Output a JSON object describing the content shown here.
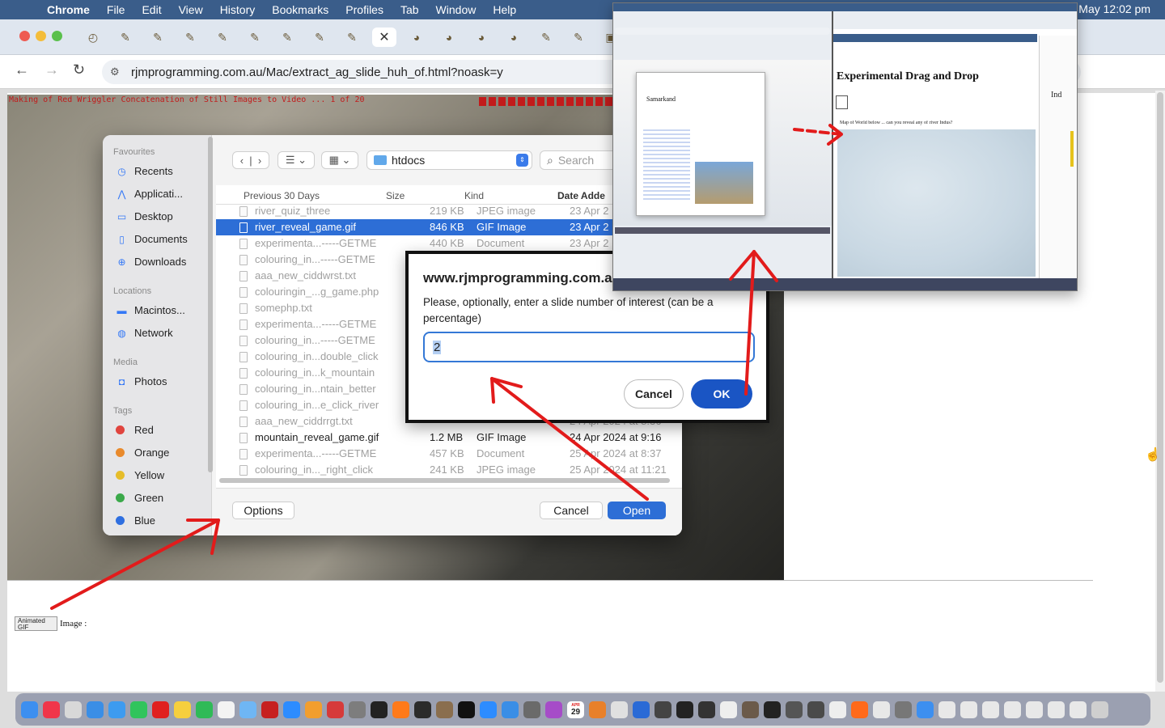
{
  "menubar": {
    "app": "Chrome",
    "items": [
      "File",
      "Edit",
      "View",
      "History",
      "Bookmarks",
      "Profiles",
      "Tab",
      "Window",
      "Help"
    ],
    "clock": "May  12:02 pm"
  },
  "browser": {
    "url": "rjmprogramming.com.au/Mac/extract_ag_slide_huh_of.html?noask=y",
    "tab_count": 20,
    "active_tab_close": "✕"
  },
  "page": {
    "strip_text": "Making of Red Wriggler Concatenation of Still Images to Video ... 1 of 20",
    "animated_gif_button": "Animated GIF",
    "image_label": "Image :"
  },
  "file_dialog": {
    "sidebar": {
      "favourites_heading": "Favourites",
      "favourites": [
        {
          "label": "Recents",
          "icon": "clock-icon"
        },
        {
          "label": "Applicati...",
          "icon": "apps-icon"
        },
        {
          "label": "Desktop",
          "icon": "desktop-icon"
        },
        {
          "label": "Documents",
          "icon": "document-icon"
        },
        {
          "label": "Downloads",
          "icon": "download-icon"
        }
      ],
      "locations_heading": "Locations",
      "locations": [
        {
          "label": "Macintos...",
          "icon": "disk-icon"
        },
        {
          "label": "Network",
          "icon": "globe-icon"
        }
      ],
      "media_heading": "Media",
      "media": [
        {
          "label": "Photos",
          "icon": "camera-icon"
        }
      ],
      "tags_heading": "Tags",
      "tags": [
        {
          "label": "Red",
          "color": "#e0443e"
        },
        {
          "label": "Orange",
          "color": "#e98a2c"
        },
        {
          "label": "Yellow",
          "color": "#e6bd2a"
        },
        {
          "label": "Green",
          "color": "#3ba94a"
        },
        {
          "label": "Blue",
          "color": "#2f6fe0"
        }
      ]
    },
    "folder": "htdocs",
    "search_placeholder": "Search",
    "columns": {
      "name": "Previous 30 Days",
      "size": "Size",
      "kind": "Kind",
      "date": "Date Adde"
    },
    "rows": [
      {
        "name": "river_quiz_three",
        "size": "219 KB",
        "kind": "JPEG image",
        "date": "23 Apr 2",
        "state": "dim"
      },
      {
        "name": "river_reveal_game.gif",
        "size": "846 KB",
        "kind": "GIF Image",
        "date": "23 Apr 2",
        "state": "selected"
      },
      {
        "name": "experimenta...-----GETME",
        "size": "440 KB",
        "kind": "Document",
        "date": "23 Apr 2",
        "state": "dim"
      },
      {
        "name": "colouring_in...-----GETME",
        "size": "",
        "kind": "",
        "date": "",
        "state": "dim"
      },
      {
        "name": "aaa_new_ciddwrst.txt",
        "size": "",
        "kind": "",
        "date": "",
        "state": "dim"
      },
      {
        "name": "colouringin_...g_game.php",
        "size": "",
        "kind": "",
        "date": "",
        "state": "dim"
      },
      {
        "name": "somephp.txt",
        "size": "",
        "kind": "",
        "date": "",
        "state": "dim"
      },
      {
        "name": "experimenta...-----GETME",
        "size": "",
        "kind": "",
        "date": "",
        "state": "dim"
      },
      {
        "name": "colouring_in...-----GETME",
        "size": "",
        "kind": "",
        "date": "",
        "state": "dim"
      },
      {
        "name": "colouring_in...double_click",
        "size": "",
        "kind": "",
        "date": "",
        "state": "dim"
      },
      {
        "name": "colouring_in...k_mountain",
        "size": "",
        "kind": "",
        "date": "",
        "state": "dim"
      },
      {
        "name": "colouring_in...ntain_better",
        "size": "",
        "kind": "",
        "date": "",
        "state": "dim"
      },
      {
        "name": "colouring_in...e_click_river",
        "size": "",
        "kind": "",
        "date": "",
        "state": "dim"
      },
      {
        "name": "aaa_new_ciddrrgt.txt",
        "size": "",
        "kind": "",
        "date": "24 Apr 2024 at 8:36",
        "state": "dim"
      },
      {
        "name": "mountain_reveal_game.gif",
        "size": "1.2 MB",
        "kind": "GIF Image",
        "date": "24 Apr 2024 at 9:16",
        "state": "dark"
      },
      {
        "name": "experimenta...-----GETME",
        "size": "457 KB",
        "kind": "Document",
        "date": "25 Apr 2024 at 8:37",
        "state": "dim"
      },
      {
        "name": "colouring_in..._right_click",
        "size": "241 KB",
        "kind": "JPEG image",
        "date": "25 Apr 2024 at 11:21",
        "state": "dim"
      }
    ],
    "options_label": "Options",
    "cancel_label": "Cancel",
    "open_label": "Open"
  },
  "prompt_dialog": {
    "title": "www.rjmprogramming.com.au",
    "message": "Please, optionally, enter a slide number of interest (can be a percentage)",
    "input_value": "2",
    "cancel_label": "Cancel",
    "ok_label": "OK"
  },
  "preview_window": {
    "left_heading": "Samarkand",
    "right_heading": "Experimental Drag and Drop",
    "right_subtext": "Map of World below ... can you reveal any of river Indus?",
    "side_heading": "Ind"
  },
  "dock": {
    "calendar_month": "APR",
    "calendar_day": "29"
  },
  "colors": {
    "accent": "#2d6ed6",
    "annotation_arrows": "#e21b1b",
    "menubar": "#3a5d8a"
  }
}
